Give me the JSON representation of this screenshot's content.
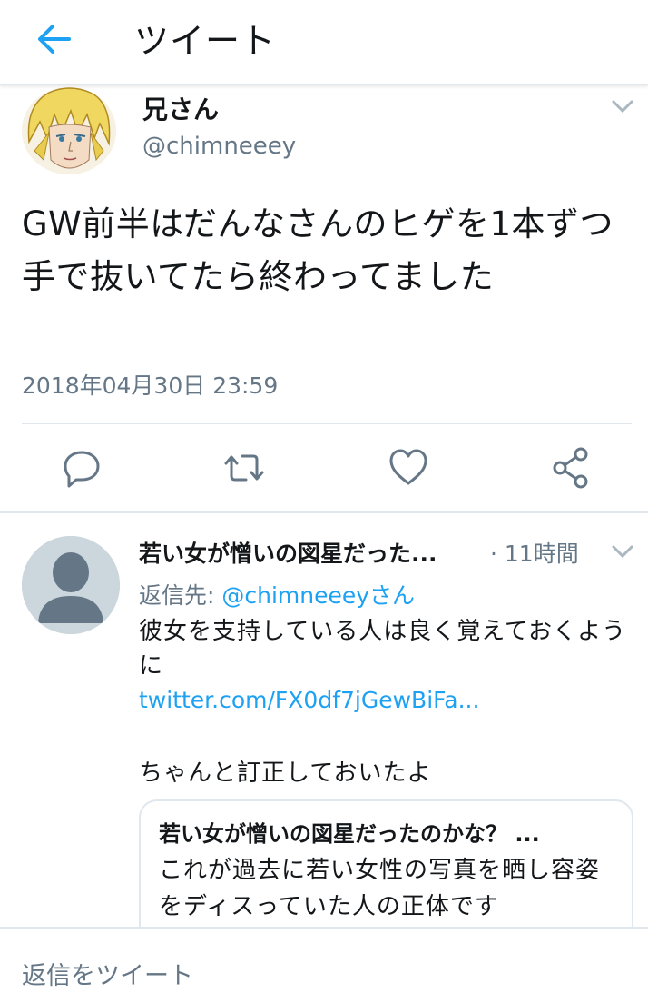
{
  "header": {
    "title": "ツイート",
    "back_icon": "back-arrow-icon"
  },
  "tweet": {
    "author_name": "兄さん",
    "author_handle": "@chimneeey",
    "text": "GW前半はだんなさんのヒゲを1本ずつ手で抜いてたら終わってました",
    "timestamp": "2018年04月30日 23:59",
    "actions": [
      "reply-icon",
      "retweet-icon",
      "like-icon",
      "share-icon"
    ]
  },
  "reply": {
    "author_name": "若い女が憎いの図星だった...",
    "time": "· 11時間",
    "reply_to_prefix": "返信先:",
    "reply_to_mention": "@chimneeeyさん",
    "text": "彼女を支持している人は良く覚えておくように",
    "link": "twitter.com/FX0df7jGewBiFa...",
    "text2": "ちゃんと訂正しておいたよ",
    "quote": {
      "title": "若い女が憎いの図星だったのかな？ ...",
      "body": "これが過去に若い女性の写真を晒し容姿をディスっていた人の正体です"
    }
  },
  "compose": {
    "placeholder": "返信をツイート"
  },
  "colors": {
    "accent": "#1da1f2",
    "secondary_text": "#657786",
    "divider": "#e1e8ed"
  }
}
